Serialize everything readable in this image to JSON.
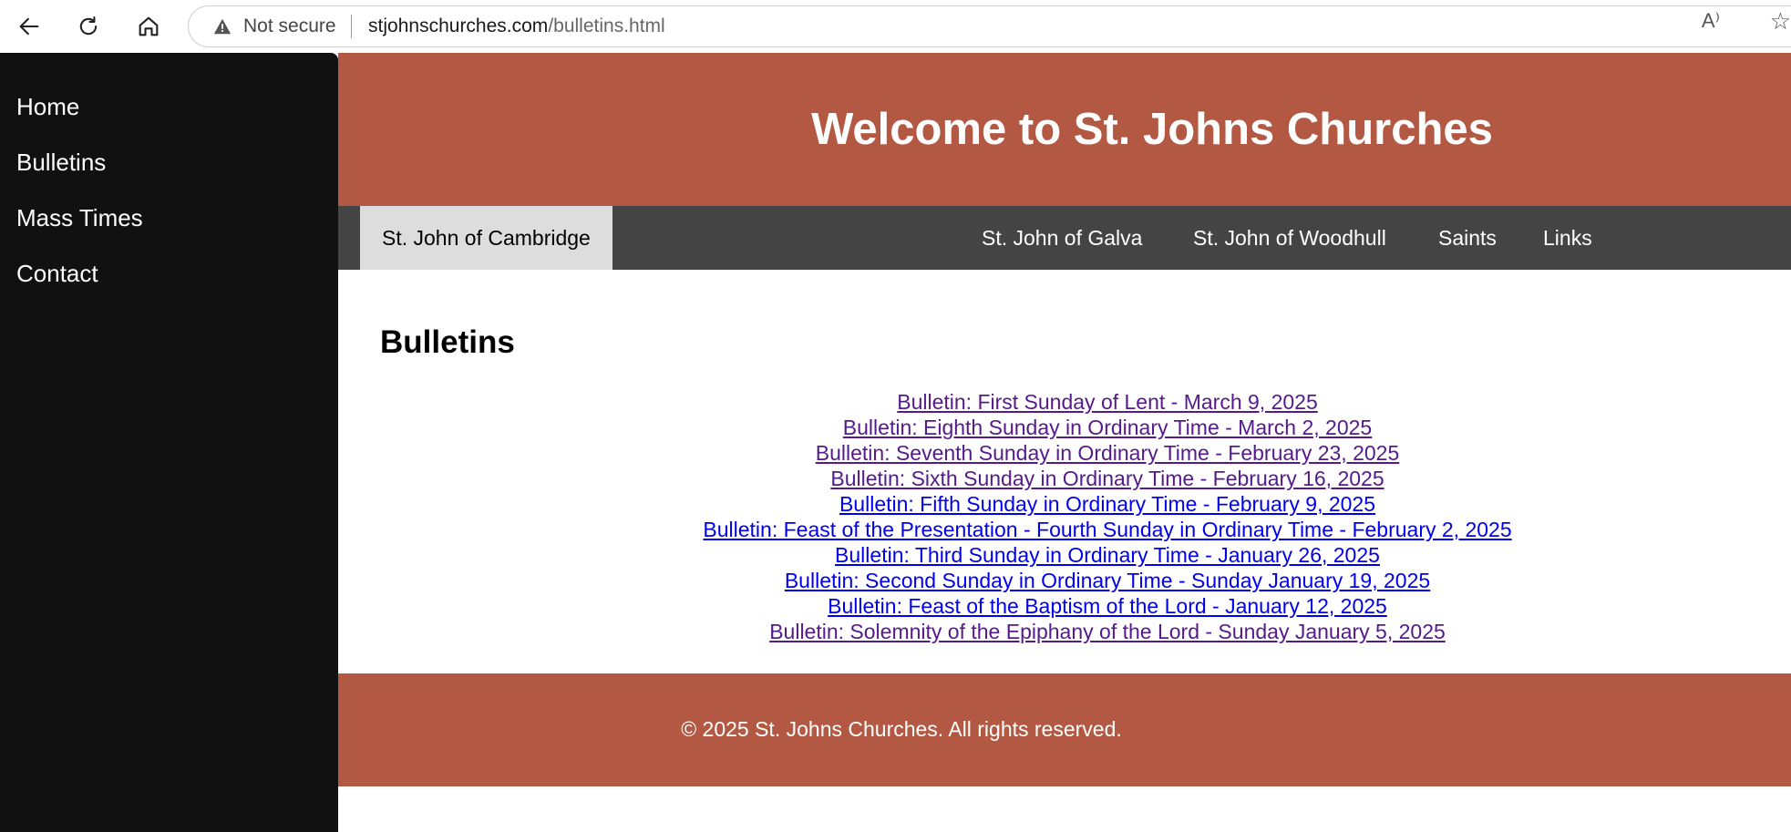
{
  "browser": {
    "not_secure_label": "Not secure",
    "url_host": "stjohnschurches.com",
    "url_path": "/bulletins.html",
    "read_aloud_glyph": "A⁾",
    "favorite_glyph": "☆"
  },
  "sidebar": {
    "items": [
      {
        "label": "Home"
      },
      {
        "label": "Bulletins"
      },
      {
        "label": "Mass Times"
      },
      {
        "label": "Contact"
      }
    ]
  },
  "header": {
    "title": "Welcome to St. Johns Churches"
  },
  "tabs": [
    {
      "label": "St. John of Cambridge",
      "active": true
    },
    {
      "label": "St. John of Galva",
      "active": false
    },
    {
      "label": "St. John of Woodhull",
      "active": false
    },
    {
      "label": "Saints",
      "active": false
    },
    {
      "label": "Links",
      "active": false
    }
  ],
  "main": {
    "heading": "Bulletins",
    "bulletins": [
      {
        "label": "Bulletin: First Sunday of Lent - March 9, 2025",
        "visited": true
      },
      {
        "label": "Bulletin: Eighth Sunday in Ordinary Time - March 2, 2025",
        "visited": true
      },
      {
        "label": "Bulletin: Seventh Sunday in Ordinary Time - February 23, 2025",
        "visited": true
      },
      {
        "label": "Bulletin: Sixth Sunday in Ordinary Time - February 16, 2025",
        "visited": true
      },
      {
        "label": "Bulletin: Fifth Sunday in Ordinary Time - February 9, 2025",
        "visited": false
      },
      {
        "label": "Bulletin: Feast of the Presentation - Fourth Sunday in Ordinary Time - February 2, 2025",
        "visited": false
      },
      {
        "label": "Bulletin: Third Sunday in Ordinary Time - January 26, 2025",
        "visited": false
      },
      {
        "label": "Bulletin: Second Sunday in Ordinary Time - Sunday January 19, 2025",
        "visited": false
      },
      {
        "label": "Bulletin: Feast of the Baptism of the Lord - January 12, 2025",
        "visited": false
      },
      {
        "label": "Bulletin: Solemnity of the Epiphany of the Lord - Sunday January 5, 2025",
        "visited": true
      }
    ]
  },
  "footer": {
    "text": "© 2025 St. Johns Churches. All rights reserved."
  },
  "colors": {
    "brand": "#b35842",
    "sidebar_bg": "#111111",
    "nav_bg": "#444444",
    "active_tab_bg": "#dddddd",
    "visited_link": "#551a8b",
    "unvisited_link": "#0000ee"
  },
  "icons": {
    "back": "back-arrow-icon",
    "reload": "reload-icon",
    "home": "home-icon",
    "warning": "warning-icon",
    "read_aloud": "read-aloud-icon",
    "favorite": "star-icon"
  }
}
